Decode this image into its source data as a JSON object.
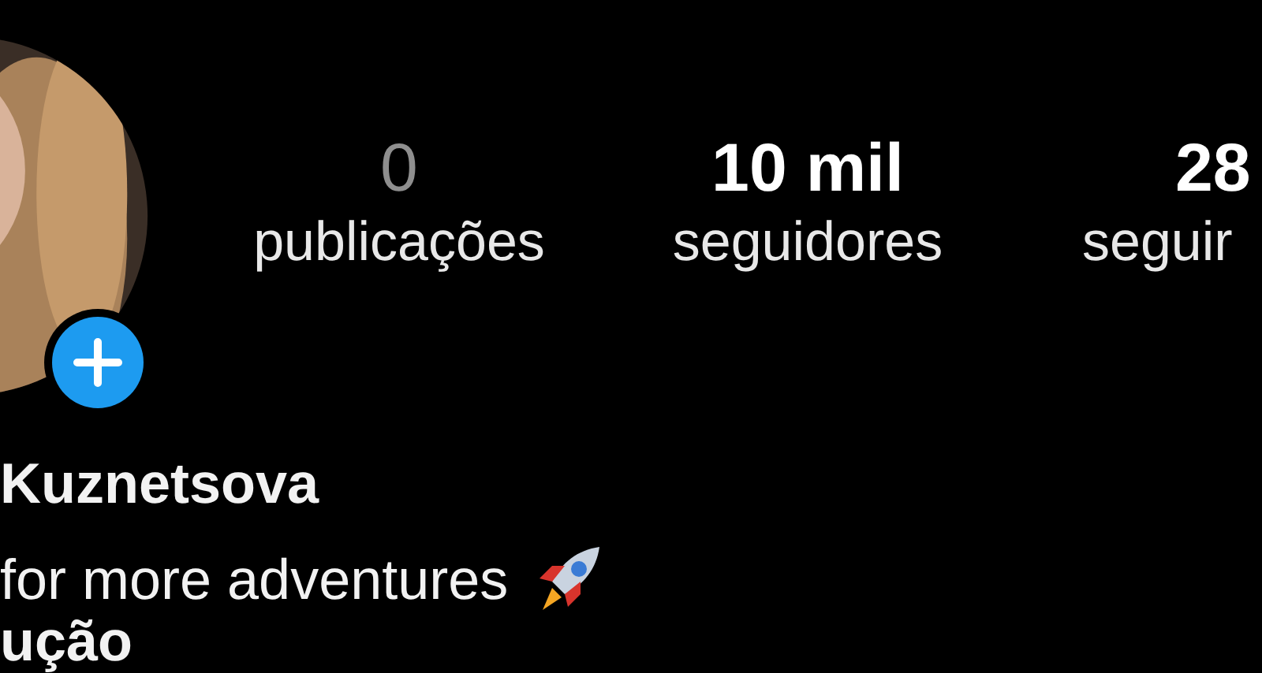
{
  "profile": {
    "stats": [
      {
        "count": "0",
        "label": "publicações",
        "dimmed": true
      },
      {
        "count": "10 mil",
        "label": "seguidores",
        "dimmed": false
      },
      {
        "count": "28",
        "label": "seguir",
        "dimmed": false
      }
    ],
    "name": "Kuznetsova",
    "bio": "for more adventures",
    "bio_line_2": "ução"
  }
}
